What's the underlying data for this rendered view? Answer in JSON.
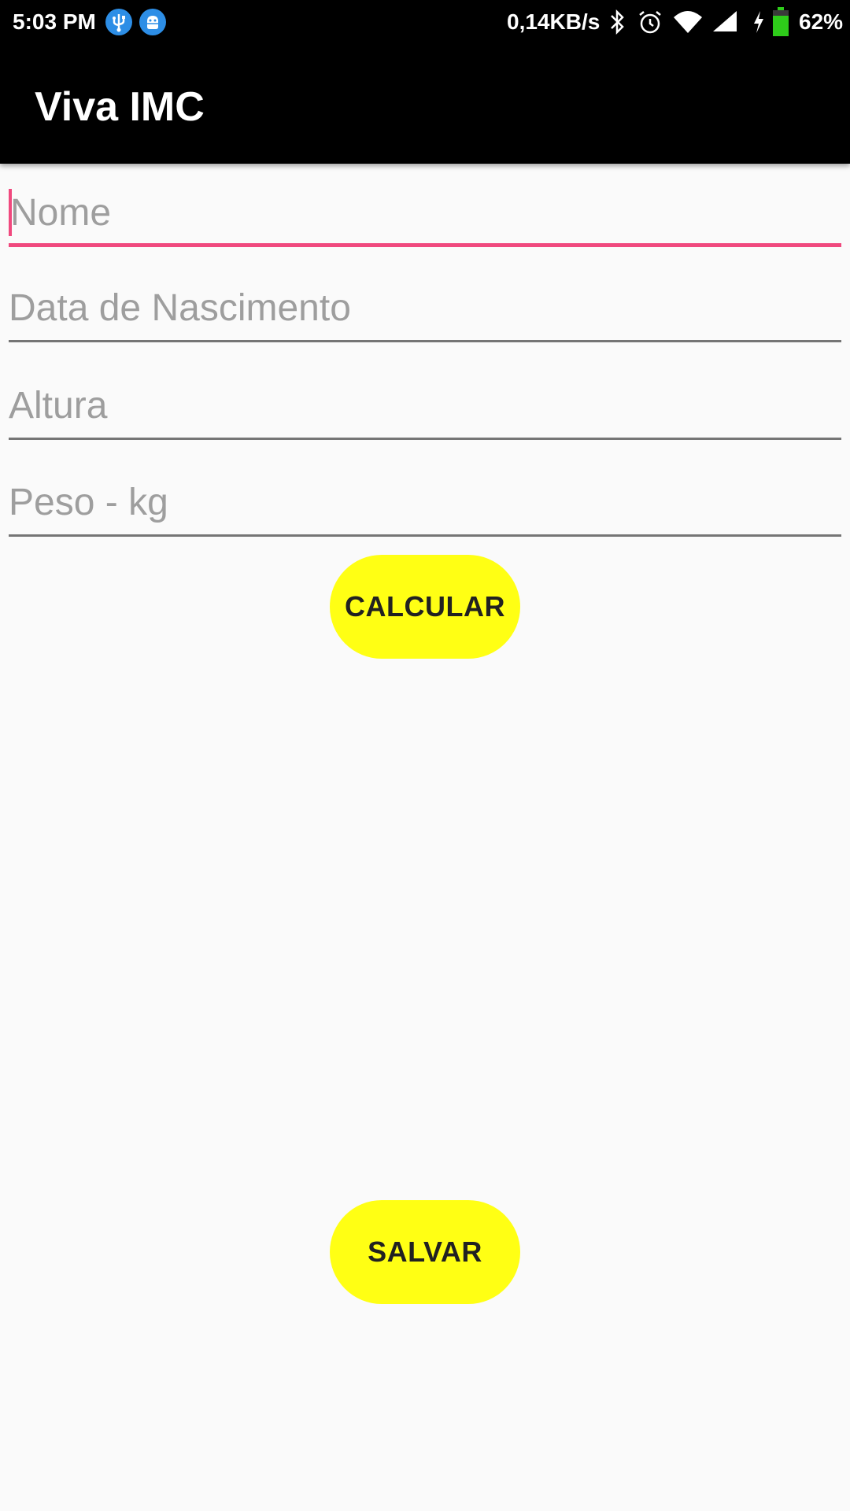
{
  "status_bar": {
    "time": "5:03 PM",
    "network_speed": "0,14KB/s",
    "battery_percent": "62%",
    "notification_icons": [
      "usb-icon",
      "android-debug-icon"
    ],
    "system_icons": [
      "bluetooth-icon",
      "alarm-icon",
      "wifi-icon",
      "cell-signal-icon",
      "charging-icon",
      "battery-icon"
    ],
    "battery_level": 0.62,
    "battery_color": "#2ecc1a"
  },
  "app_bar": {
    "title": "Viva IMC",
    "background": "#000000"
  },
  "form": {
    "fields": [
      {
        "placeholder": "Nome",
        "value": "",
        "focused": true
      },
      {
        "placeholder": "Data de Nascimento",
        "value": "",
        "focused": false
      },
      {
        "placeholder": "Altura",
        "value": "",
        "focused": false
      },
      {
        "placeholder": "Peso - kg",
        "value": "",
        "focused": false
      }
    ],
    "accent_color": "#f0497e"
  },
  "buttons": {
    "calcular_label": "CALCULAR",
    "salvar_label": "SALVAR",
    "color": "#ffff14"
  }
}
